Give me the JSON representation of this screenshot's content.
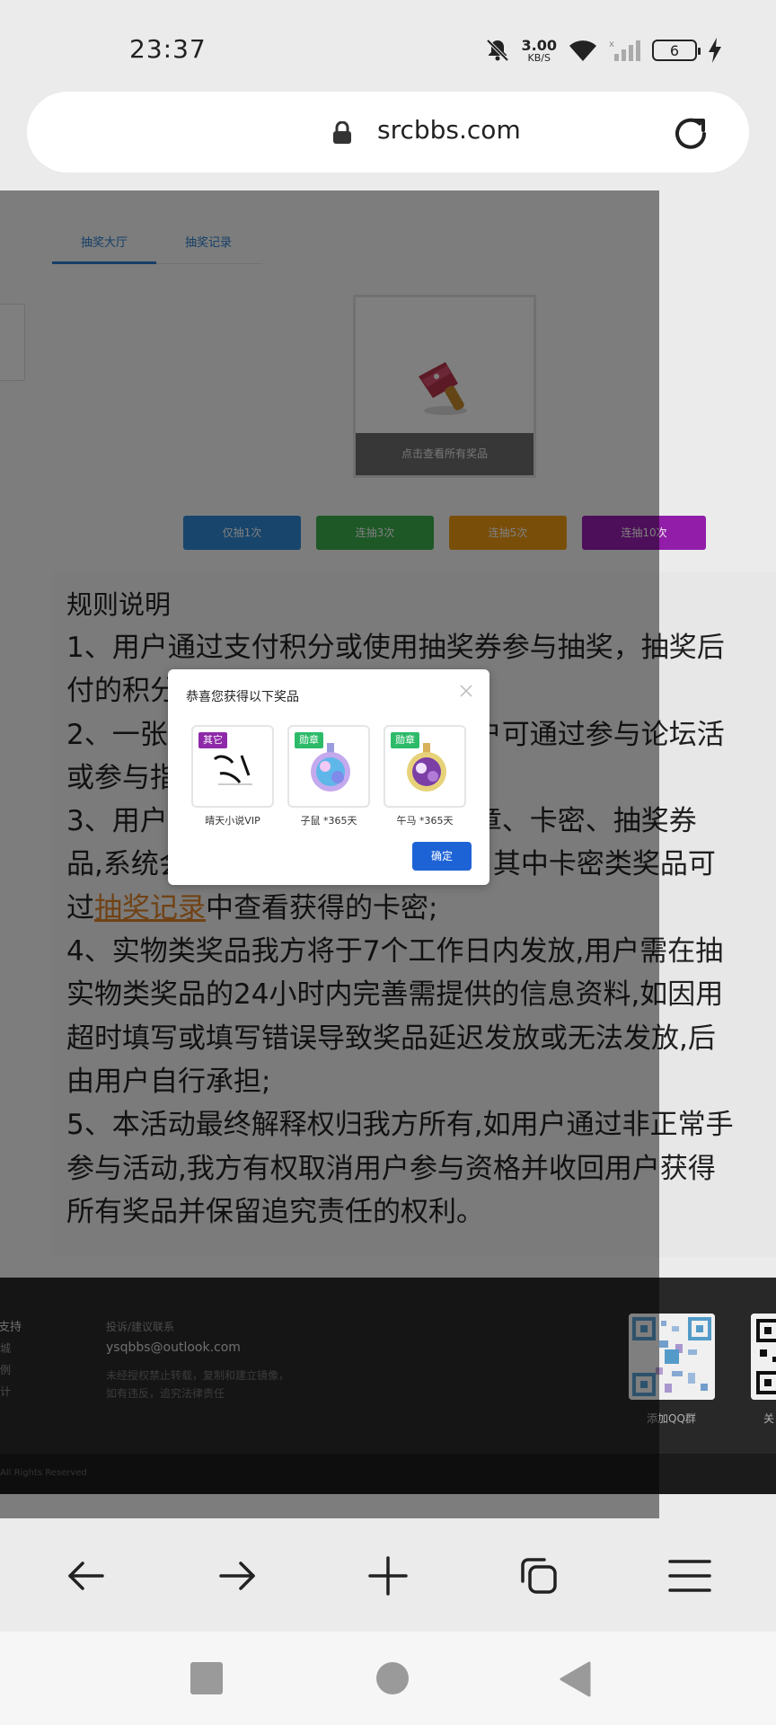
{
  "status": {
    "time": "23:37",
    "net_speed_value": "3.00",
    "net_speed_unit": "KB/S",
    "battery": "6"
  },
  "address_bar": {
    "url": "srcbbs.com"
  },
  "page": {
    "tabs": [
      "抽奖大厅",
      "抽奖记录"
    ],
    "view_all_prizes": "点击查看所有奖品",
    "draw_buttons": [
      {
        "label": "仅抽1次",
        "color": "#2f8ad8"
      },
      {
        "label": "连抽3次",
        "color": "#3bb04d"
      },
      {
        "label": "连抽5次",
        "color": "#f39c12"
      },
      {
        "label": "连抽10次",
        "color": "#9b1fb3"
      }
    ],
    "rules": {
      "title": "规则说明",
      "line1": "1、用户通过支付积分或使用抽奖券参与抽奖，抽奖后",
      "line2": "付的积分或抽奖券将不予退还;",
      "line3": "2、一张抽奖券可以抽奖一次，用户可通过参与论坛活",
      "line4": "或参与指定活动获得抽奖券;",
      "line5": "3、用户可以抽取积分、道具、勋章、卡密、抽奖券",
      "line6": "品,系统会自动发放到用户账户中，其中卡密类奖品可",
      "line7_pre": "过",
      "line7_link": "抽奖记录",
      "line7_post": "中查看获得的卡密;",
      "line8": "4、实物类奖品我方将于7个工作日内发放,用户需在抽",
      "line9": "实物类奖品的24小时内完善需提供的信息资料,如因用",
      "line10": "超时填写或填写错误导致奖品延迟发放或无法发放,后",
      "line11": "由用户自行承担;",
      "line12": "5、本活动最终解释权归我方所有,如用户通过非正常手",
      "line13": "参与活动,我方有权取消用户参与资格并收回用户获得",
      "line14": "所有奖品并保留追究责任的权利。"
    },
    "footer": {
      "left_title": "支持",
      "left_items": [
        "城",
        "例",
        "计"
      ],
      "contact_title": "投诉/建议联系",
      "email": "ysqbbs@outlook.com",
      "notice_line1": "未经授权禁止转载，复制和建立镜像，",
      "notice_line2": "如有违反，追究法律责任",
      "qr1_label": "添加QQ群",
      "qr2_label": "关",
      "copyright": "All Rights Reserved"
    }
  },
  "modal": {
    "title": "恭喜您获得以下奖品",
    "prizes": [
      {
        "tag": "其它",
        "tag_color": "#8e2aa8",
        "name": "晴天小说VIP",
        "art_text": "晴天"
      },
      {
        "tag": "勋章",
        "tag_color": "#2dbb6a",
        "name": "子鼠 *365天"
      },
      {
        "tag": "勋章",
        "tag_color": "#2dbb6a",
        "name": "午马 *365天"
      }
    ],
    "ok_label": "确定"
  }
}
